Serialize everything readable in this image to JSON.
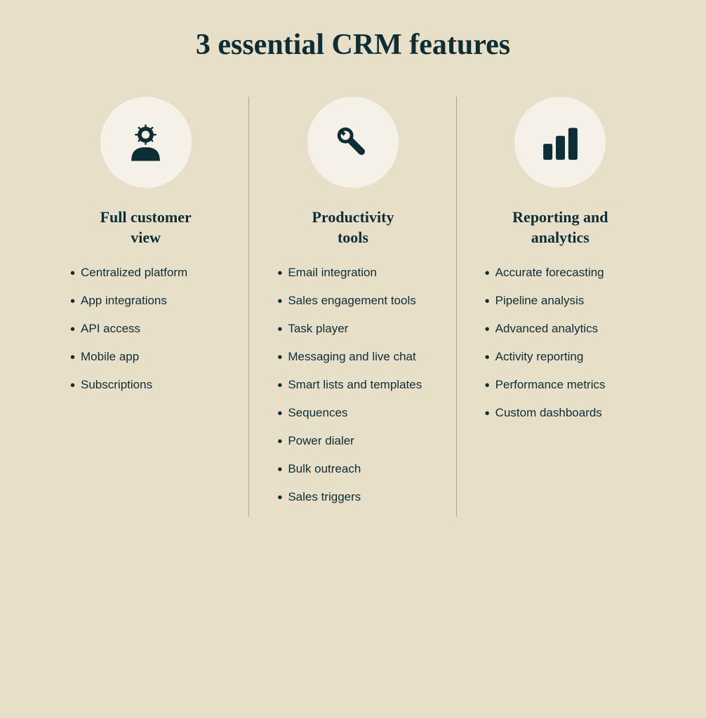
{
  "page": {
    "title": "3 essential CRM features",
    "background_color": "#e8dfc8"
  },
  "columns": [
    {
      "id": "full-customer-view",
      "icon": "person",
      "title": "Full customer view",
      "items": [
        "Centralized platform",
        "App integrations",
        "API access",
        "Mobile app",
        "Subscriptions"
      ]
    },
    {
      "id": "productivity-tools",
      "icon": "wrench",
      "title": "Productivity tools",
      "items": [
        "Email integration",
        "Sales engagement tools",
        "Task player",
        "Messaging and live chat",
        "Smart lists and templates",
        "Sequences",
        "Power dialer",
        "Bulk outreach",
        "Sales triggers"
      ]
    },
    {
      "id": "reporting-analytics",
      "icon": "chart",
      "title": "Reporting and analytics",
      "items": [
        "Accurate forecasting",
        "Pipeline analysis",
        "Advanced analytics",
        "Activity reporting",
        "Performance metrics",
        "Custom dashboards"
      ]
    }
  ]
}
